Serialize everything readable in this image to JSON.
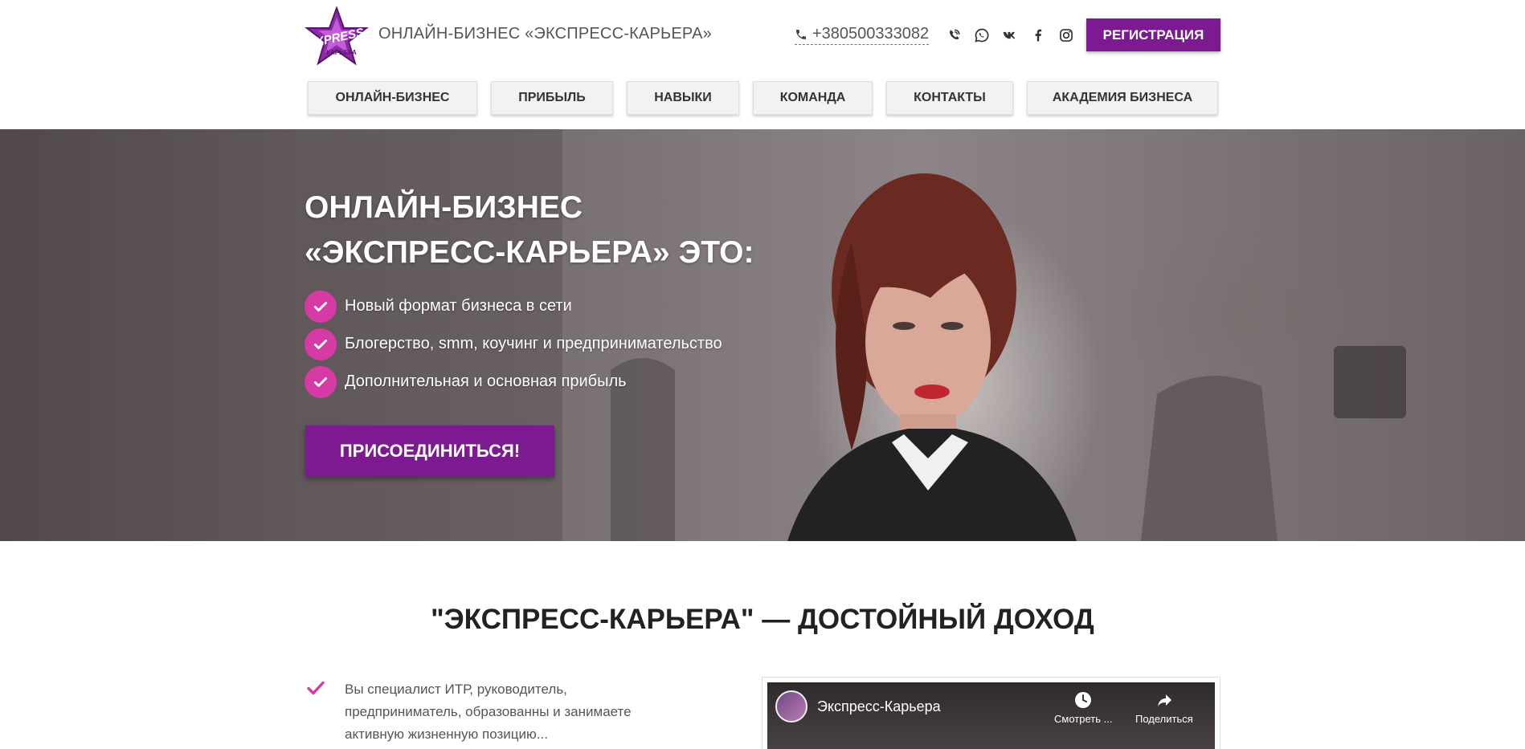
{
  "header": {
    "logo": {
      "text": "EXPRESS КАРЬЕРА",
      "icon": "star-logo"
    },
    "site_title": "ОНЛАЙН-БИЗНЕС «ЭКСПРЕСС-КАРЬЕРА»",
    "phone": "+380500333082",
    "socials": [
      {
        "icon": "viber-icon"
      },
      {
        "icon": "whatsapp-icon"
      },
      {
        "icon": "vk-icon"
      },
      {
        "icon": "facebook-icon"
      },
      {
        "icon": "instagram-icon"
      }
    ],
    "register_label": "РЕГИСТРАЦИЯ"
  },
  "nav": {
    "items": [
      {
        "label": "ОНЛАЙН-БИЗНЕС"
      },
      {
        "label": "ПРИБЫЛЬ"
      },
      {
        "label": "НАВЫКИ"
      },
      {
        "label": "КОМАНДА"
      },
      {
        "label": "КОНТАКТЫ"
      },
      {
        "label": "АКАДЕМИЯ БИЗНЕСА"
      }
    ]
  },
  "hero": {
    "title_line1": "ОНЛАЙН-БИЗНЕС",
    "title_line2": "«ЭКСПРЕСС-КАРЬЕРА» ЭТО:",
    "benefits": [
      {
        "text": "Новый формат бизнеса в сети"
      },
      {
        "text": "Блогерство, smm, коучинг и предпринимательство"
      },
      {
        "text": "Дополнительная и основная прибыль"
      }
    ],
    "join_label": "ПРИСОЕДИНИТЬСЯ!"
  },
  "section": {
    "title": "\"ЭКСПРЕСС-КАРЬЕРА\" — ДОСТОЙНЫЙ ДОХОД",
    "feature_text": "Вы специалист ИТР, руководитель, предприниматель, образованны и занимаете активную жизненную позицию..."
  },
  "video": {
    "channel_title": "Экспресс-Карьера",
    "watch_later": "Смотреть ...",
    "share": "Поделиться"
  },
  "colors": {
    "brand_purple": "#7d1a91",
    "check_pink": "#d63aa5"
  }
}
